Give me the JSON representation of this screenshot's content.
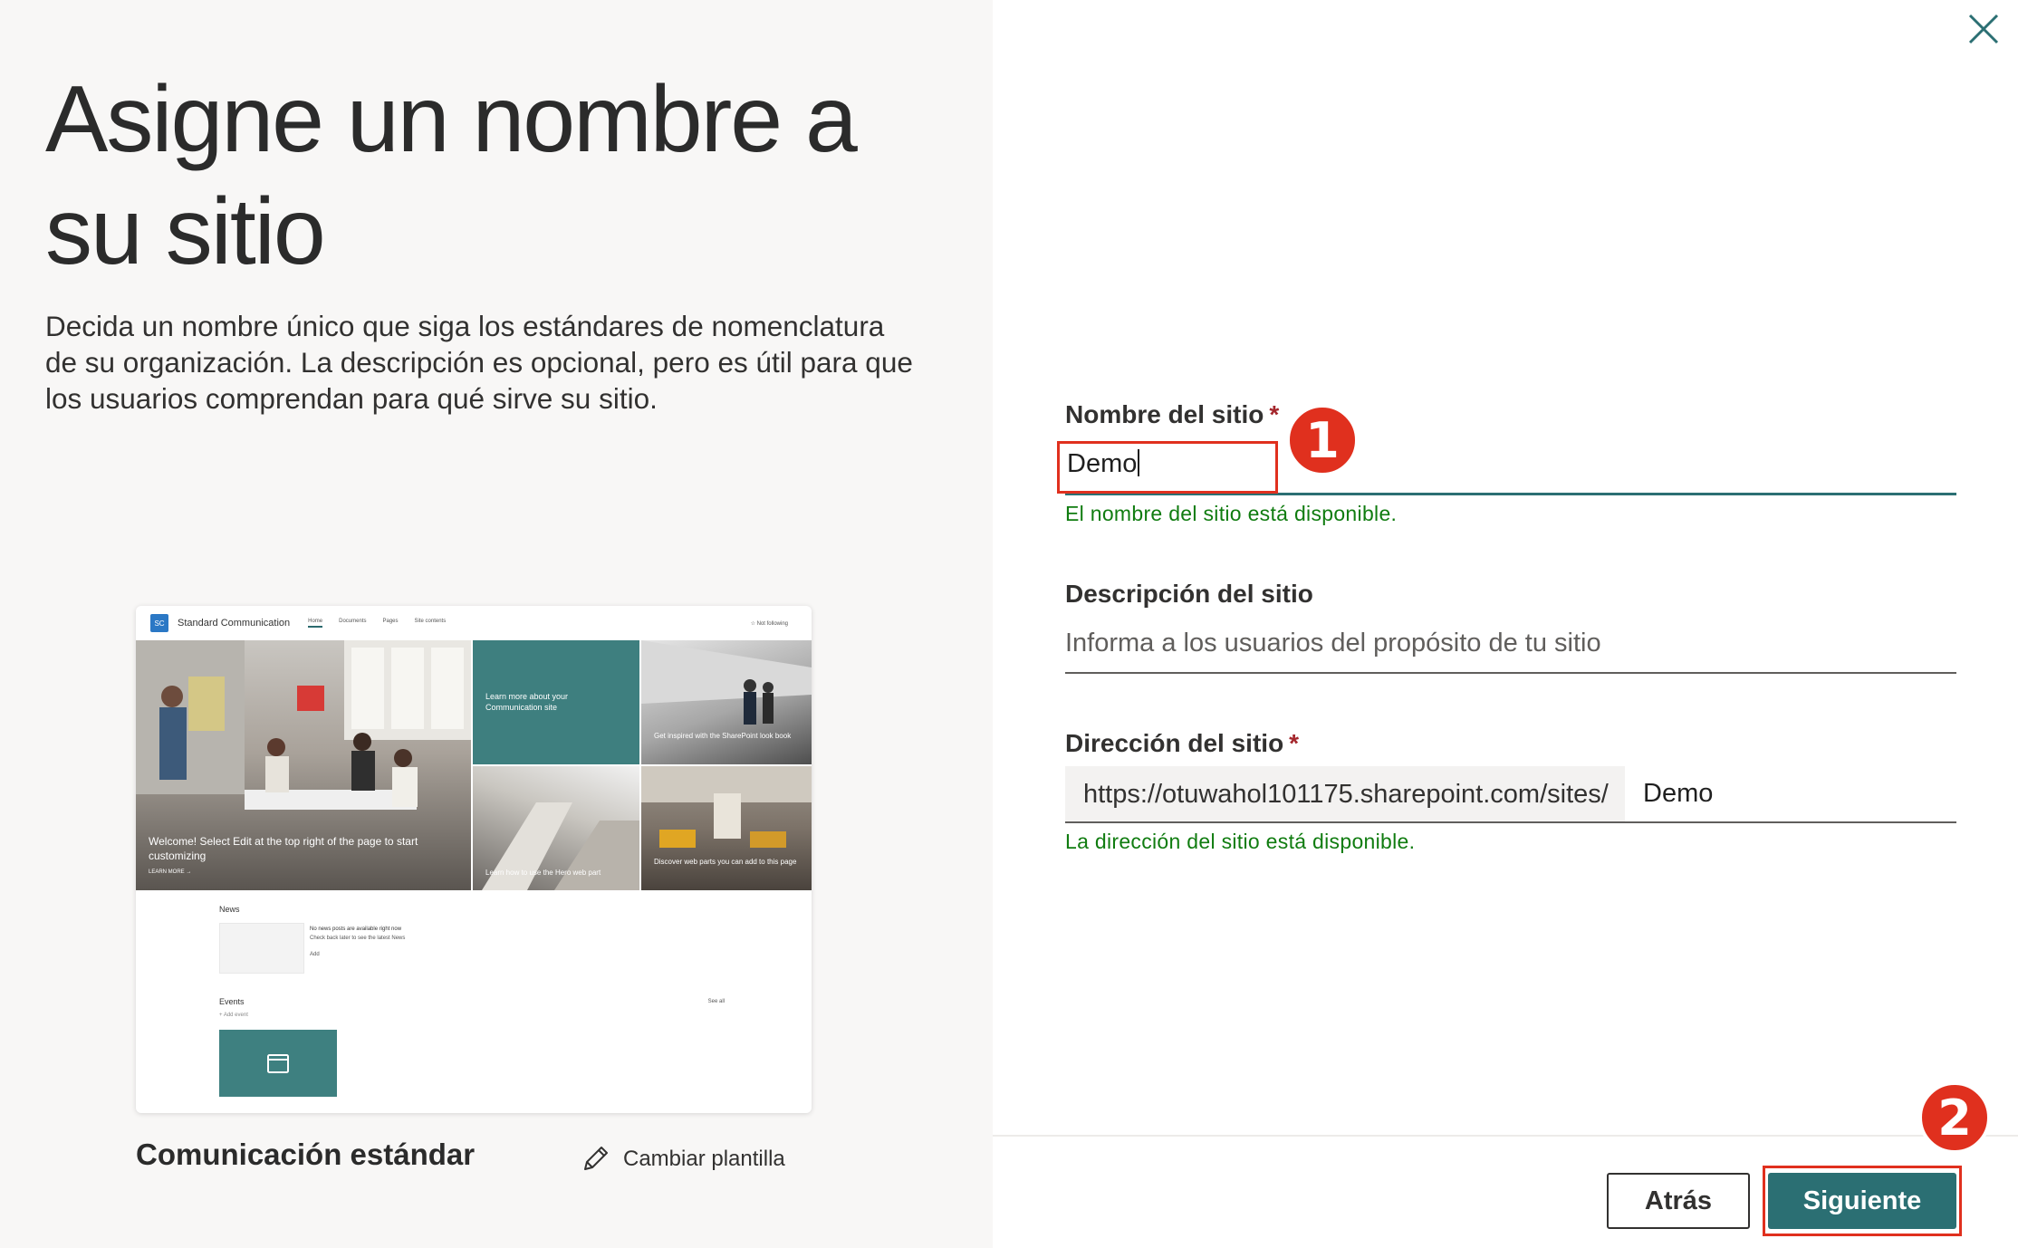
{
  "left_panel": {
    "title_line1": "Asigne un nombre a",
    "title_line2": "su sitio",
    "description": "Decida un nombre único que siga los estándares de nomenclatura de su organización. La descripción es opcional, pero es útil para que los usuarios comprendan para qué sirve su sitio.",
    "template_name": "Comunicación estándar",
    "change_template_label": "Cambiar plantilla"
  },
  "preview": {
    "logo": "SC",
    "site_name": "Standard Communication",
    "nav": [
      "Home",
      "Documents",
      "Pages",
      "Site contents"
    ],
    "follow": "☆ Not following",
    "hero_main_text": "Welcome! Select Edit at the top right of the page to start customizing",
    "hero_main_link": "LEARN MORE →",
    "tile_teal_text": "Learn more about your Communication site",
    "tile_top_right_text": "Get inspired with the SharePoint look book",
    "tile_bottom_mid_text": "Learn how to use the Hero web part",
    "tile_bottom_right_text": "Discover web parts you can add to this page",
    "news_label": "News",
    "news_empty_title": "No news posts are available right now",
    "news_empty_sub": "Check back later to see the latest News",
    "news_more": "Add",
    "events_label": "Events",
    "see_all": "See all",
    "add_event": "+ Add event"
  },
  "form": {
    "site_name_label": "Nombre del sitio",
    "required_mark": "*",
    "site_name_value": "Demo",
    "site_name_status": "El nombre del sitio está disponible.",
    "description_label": "Descripción del sitio",
    "description_placeholder": "Informa a los usuarios del propósito de tu sitio",
    "address_label": "Dirección del sitio",
    "address_prefix": "https://otuwahol101175.sharepoint.com/sites/",
    "address_value": "Demo",
    "address_status": "La dirección del sitio está disponible."
  },
  "footer": {
    "back_label": "Atrás",
    "next_label": "Siguiente"
  },
  "annotations": {
    "badge_1": "1",
    "badge_2": "2"
  },
  "colors": {
    "accent": "#2b6f73",
    "success": "#107c10",
    "required": "#a4262c",
    "highlight": "#e0301e",
    "left_bg": "#f8f7f6"
  },
  "icons": {
    "close": "close-icon",
    "edit": "pencil-icon",
    "calendar": "calendar-icon"
  }
}
